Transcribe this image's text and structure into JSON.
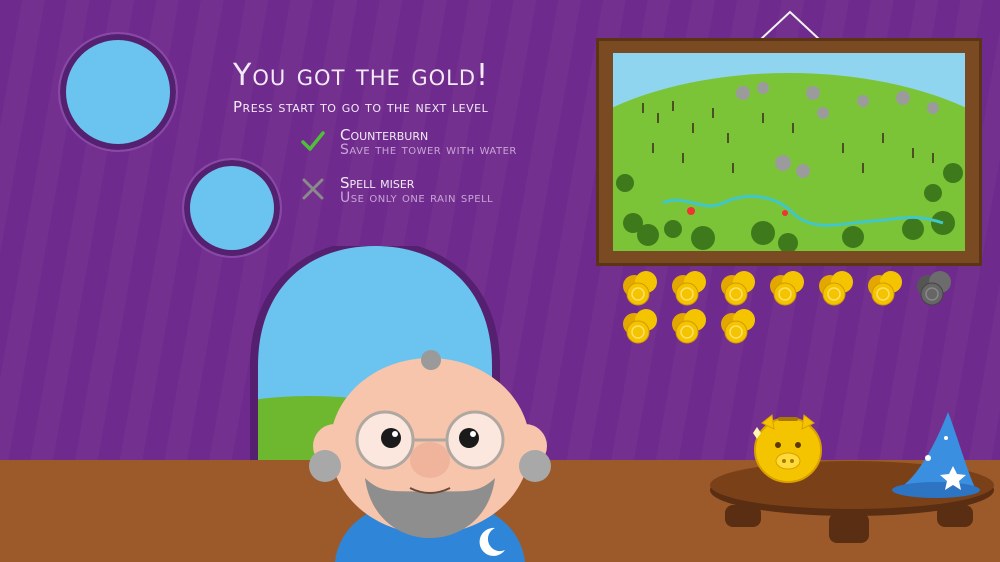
{
  "screen": {
    "title": "You got the gold!",
    "subtitle": "Press start to go to the next level"
  },
  "goals": [
    {
      "name": "Counterburn",
      "description": "Save the tower with water",
      "status": "complete"
    },
    {
      "name": "Spell miser",
      "description": "Use only one rain spell",
      "status": "failed"
    }
  ],
  "coins": {
    "gold": 9,
    "gray": 1
  },
  "colors": {
    "wall": "#6e2b8d",
    "gold": "#f5c400",
    "check": "#4fbf3a",
    "cross": "#8a8a8a",
    "sky": "#6bc3ef"
  },
  "icons": [
    "check-icon",
    "cross-icon",
    "piggy-bank-icon",
    "wizard-hat-icon",
    "gold-coin-icon"
  ]
}
